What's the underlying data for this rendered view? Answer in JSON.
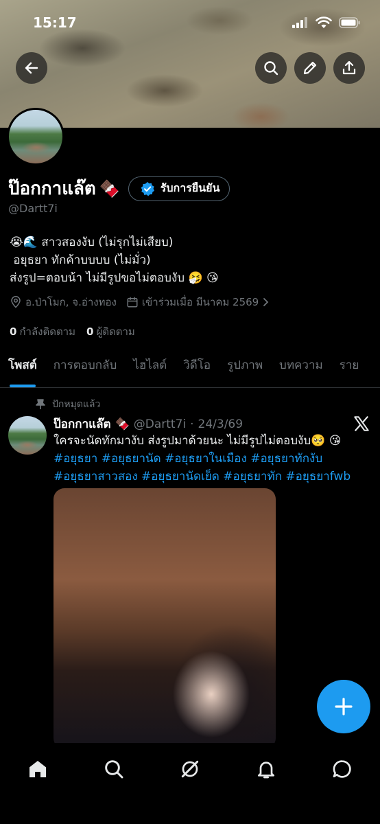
{
  "status_bar": {
    "time": "15:17"
  },
  "profile": {
    "display_name": "ป๊อกกาแล๊ต",
    "name_emoji": "🍫",
    "verify_label": "รับการยืนยัน",
    "handle": "@Dartt7i",
    "bio_lines": [
      "😭🌊 สาวสองงับ (ไม่รุกไม่เสียบ)",
      " อยุธยา ทักค้าบบบบ (ไม่มั่ว)",
      "ส่งรูป=ตอบน้า ไม่มีรูปขอไม่ตอบงับ 🤧 😘"
    ],
    "location": "อ.ป่าโมก, จ.อ่างทอง",
    "joined": "เข้าร่วมเมื่อ มีนาคม 2569",
    "following_count": "0",
    "following_label": "กำลังติดตาม",
    "followers_count": "0",
    "followers_label": "ผู้ติดตาม"
  },
  "tabs": [
    {
      "label": "โพสต์",
      "active": true
    },
    {
      "label": "การตอบกลับ"
    },
    {
      "label": "ไฮไลต์"
    },
    {
      "label": "วิดีโอ"
    },
    {
      "label": "รูปภาพ"
    },
    {
      "label": "บทความ"
    },
    {
      "label": "ราย"
    }
  ],
  "post": {
    "pinned_label": "ปักหมุดแล้ว",
    "author_name": "ป๊อกกาแล๊ต",
    "author_emoji": "🍫",
    "author_handle": "@Dartt7i",
    "separator": "·",
    "date": "24/3/69",
    "text": "ใครจะนัดทักมางับ ส่งรูปมาด้วยนะ ไม่มีรูปไม่ตอบงับ🥺 😘",
    "hashtags": "#อยุธยา #อยุธยานัด #อยุธยาในเมือง #อยุธยาทักงับ #อยุธยาสาวสอง #อยุธยานัดเย็ด #อยุธยาทัก #อยุธยาfwb"
  },
  "icons": {
    "back": "arrow-left-icon",
    "search": "search-icon",
    "edit": "pencil-icon",
    "share": "share-icon",
    "verified": "verified-badge-icon",
    "location": "location-pin-icon",
    "calendar": "calendar-icon",
    "pin": "pin-icon",
    "x_logo": "x-logo-icon",
    "compose": "plus-icon",
    "nav": [
      "home-icon",
      "search-icon",
      "grok-icon",
      "bell-icon",
      "messages-icon"
    ]
  },
  "colors": {
    "accent": "#1d9bf0",
    "background": "#000000",
    "muted": "#71767b"
  }
}
